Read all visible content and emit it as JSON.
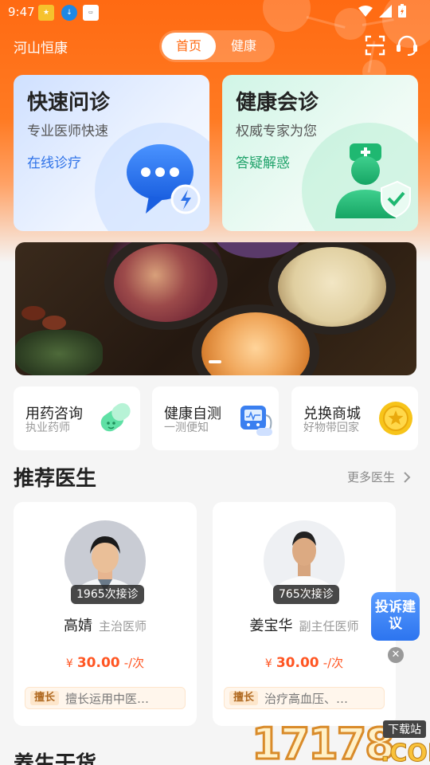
{
  "status_bar": {
    "time": "9:47"
  },
  "header": {
    "location": "河山恒康",
    "tabs": [
      {
        "label": "首页",
        "active": true
      },
      {
        "label": "健康",
        "active": false
      }
    ],
    "icons": [
      "scan-icon",
      "customer-service-icon"
    ],
    "accent_color": "#ff6a12"
  },
  "consult_cards": [
    {
      "title": "快速问诊",
      "subtitle": "专业医师快速",
      "tag": "在线诊疗",
      "tag_color": "#2e72e8",
      "icon": "chat-bubble-icon"
    },
    {
      "title": "健康会诊",
      "subtitle": "权威专家为您",
      "tag": "答疑解惑",
      "tag_color": "#21a36b",
      "icon": "doctor-shield-icon"
    }
  ],
  "banner": {
    "slide_count": 2,
    "active_index": 0
  },
  "features": [
    {
      "title": "用药咨询",
      "subtitle": "执业药师",
      "icon": "capsule-icon"
    },
    {
      "title": "健康自测",
      "subtitle": "一测便知",
      "icon": "blood-pressure-icon"
    },
    {
      "title": "兑换商城",
      "subtitle": "好物带回家",
      "icon": "gold-coin-icon"
    }
  ],
  "recommended": {
    "title": "推荐医生",
    "more_label": "更多医生",
    "doctors": [
      {
        "name": "高婧",
        "title": "主治医师",
        "visits": "1965次接诊",
        "currency": "¥",
        "price": "30.00",
        "unit": "-/次",
        "spec_tag": "擅长",
        "speciality": "擅长运用中医…"
      },
      {
        "name": "姜宝华",
        "title": "副主任医师",
        "visits": "765次接诊",
        "currency": "¥",
        "price": "30.00",
        "unit": "-/次",
        "spec_tag": "擅长",
        "speciality": "治疗高血压、…"
      }
    ]
  },
  "feedback": {
    "label": "投诉建议",
    "close": "✕"
  },
  "next_section": {
    "title": "养生干货"
  },
  "watermark": {
    "number": "17178",
    "tag": "下载站",
    "suffix": ".COM"
  }
}
